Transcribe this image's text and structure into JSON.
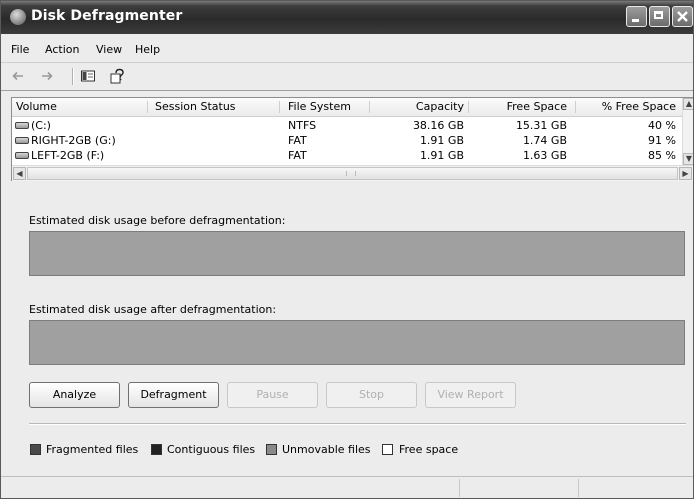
{
  "window": {
    "title": "Disk Defragmenter"
  },
  "menu": {
    "items": [
      "File",
      "Action",
      "View",
      "Help"
    ]
  },
  "toolbar": {
    "icons": [
      "back-arrow-icon",
      "forward-arrow-icon",
      "show-hide-pane-icon",
      "help-icon"
    ]
  },
  "volumes": {
    "columns": [
      "Volume",
      "Session Status",
      "File System",
      "Capacity",
      "Free Space",
      "% Free Space"
    ],
    "rows": [
      {
        "volume": "(C:)",
        "status": "",
        "fs": "NTFS",
        "capacity": "38.16 GB",
        "free": "15.31 GB",
        "pct": "40 %"
      },
      {
        "volume": "RIGHT-2GB (G:)",
        "status": "",
        "fs": "FAT",
        "capacity": "1.91 GB",
        "free": "1.74 GB",
        "pct": "91 %"
      },
      {
        "volume": "LEFT-2GB (F:)",
        "status": "",
        "fs": "FAT",
        "capacity": "1.91 GB",
        "free": "1.63 GB",
        "pct": "85 %"
      }
    ]
  },
  "usage": {
    "before_label": "Estimated disk usage before defragmentation:",
    "after_label": "Estimated disk usage after defragmentation:"
  },
  "buttons": {
    "analyze": "Analyze",
    "defragment": "Defragment",
    "pause": "Pause",
    "stop": "Stop",
    "view_report": "View Report"
  },
  "legend": {
    "items": [
      {
        "label": "Fragmented files",
        "color": "#4a4a4a"
      },
      {
        "label": "Contiguous files",
        "color": "#222222"
      },
      {
        "label": "Unmovable files",
        "color": "#8a8a8a"
      },
      {
        "label": "Free space",
        "color": "#ffffff"
      }
    ]
  }
}
